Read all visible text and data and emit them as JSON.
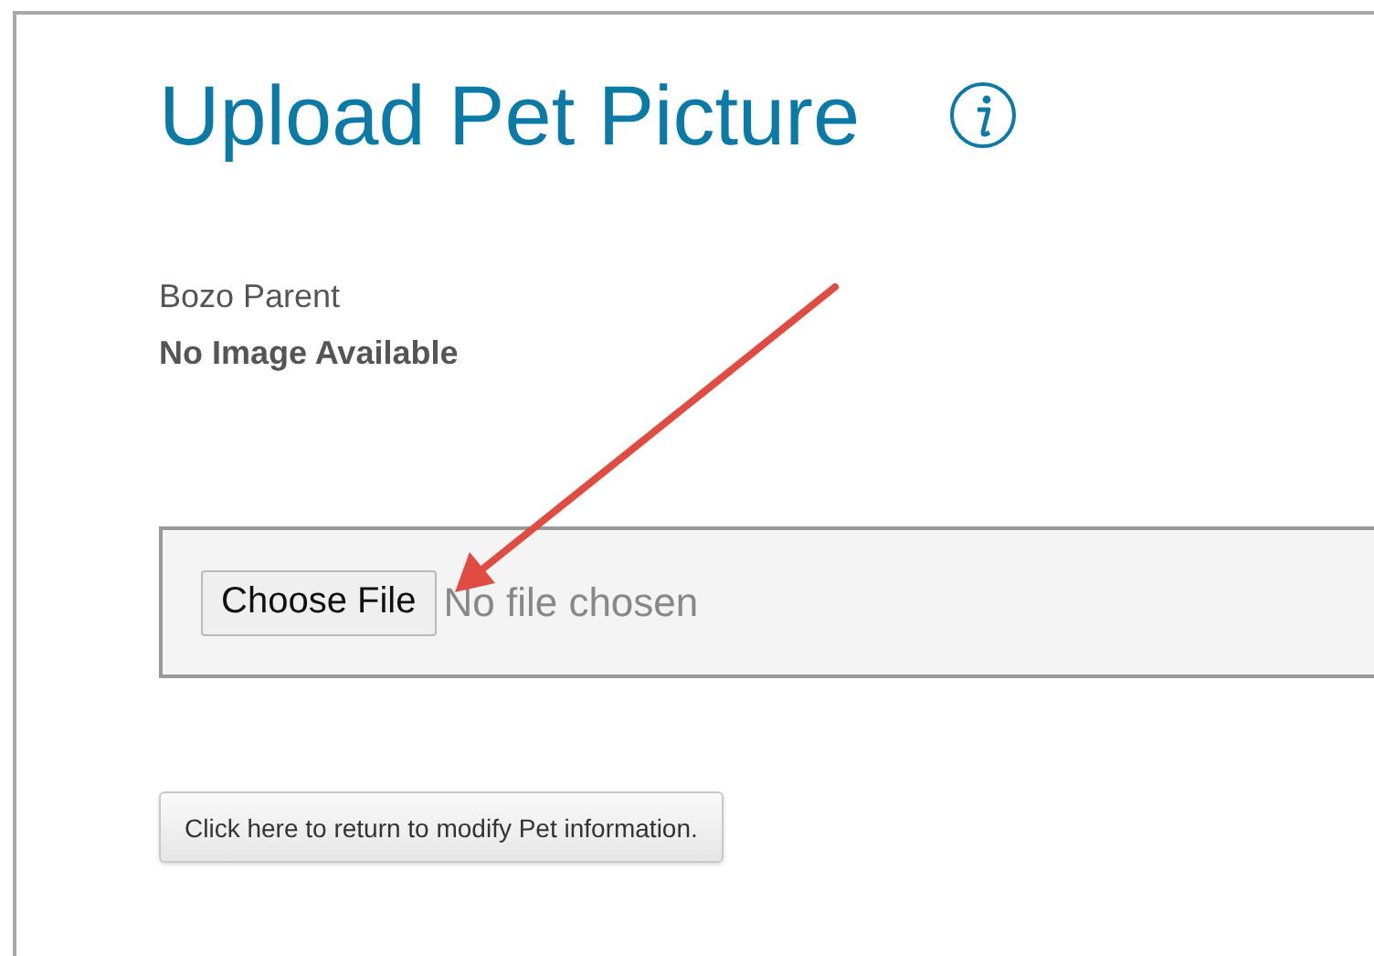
{
  "page": {
    "title": "Upload Pet Picture"
  },
  "pet": {
    "name": "Bozo Parent",
    "image_status": "No Image Available"
  },
  "upload": {
    "button": "Choose File",
    "file_status": "No file chosen"
  },
  "buttons": [
    "Click here to return to modify Pet information."
  ]
}
